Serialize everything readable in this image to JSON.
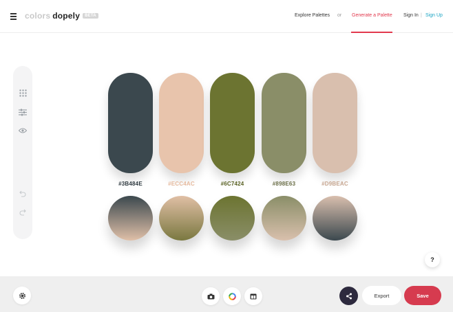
{
  "header": {
    "logo_colors": "colors",
    "logo_dopely": "dopely",
    "beta": "BETA",
    "nav": {
      "explore": "Explore Palettes",
      "or": "or",
      "generate": "Generate a Palette",
      "signin": "Sign In",
      "separator": "|",
      "signup": "Sign Up"
    }
  },
  "palette": [
    {
      "hex": "#3B484E",
      "color": "#3b484e",
      "label_color": "#2f3a40",
      "gradient": [
        "#3b484e",
        "#e0c0a8"
      ]
    },
    {
      "hex": "#ECC4AC",
      "color": "#e8c4ac",
      "label_color": "#e6b99d",
      "gradient": [
        "#e0bfa5",
        "#7a7840"
      ]
    },
    {
      "hex": "#6C7424",
      "color": "#6c7431",
      "label_color": "#5a6224",
      "gradient": [
        "#6c7431",
        "#8a8e68"
      ]
    },
    {
      "hex": "#898E63",
      "color": "#8a8e68",
      "label_color": "#6b6f48",
      "gradient": [
        "#8a8e68",
        "#d9c0ad"
      ]
    },
    {
      "hex": "#D9BEAC",
      "color": "#d9bfae",
      "label_color": "#c6a58f",
      "gradient": [
        "#d9bfae",
        "#3b484e"
      ]
    }
  ],
  "icons": {
    "hamburger": "hamburger-icon",
    "grid": "grid-icon",
    "sliders": "sliders-icon",
    "eye": "eye-icon",
    "undo": "undo-icon",
    "redo": "redo-icon",
    "settings": "gear-icon",
    "camera": "camera-icon",
    "color_wheel": "color-wheel-icon",
    "layout": "layout-icon",
    "share": "share-icon"
  },
  "help_label": "?",
  "actions": {
    "export": "Export",
    "save": "Save"
  }
}
